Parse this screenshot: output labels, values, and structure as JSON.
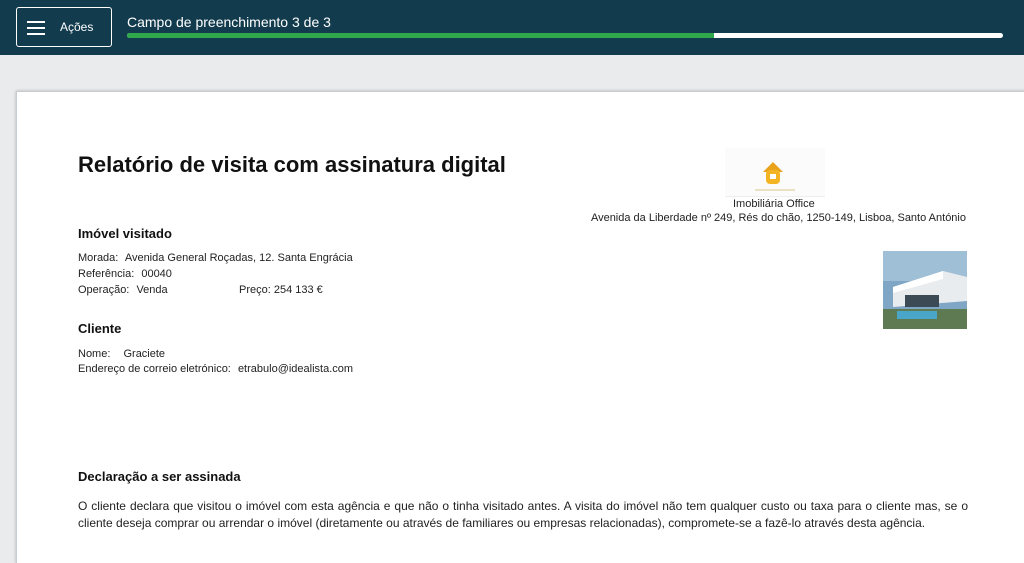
{
  "header": {
    "actions_label": "Ações",
    "progress_text": "Campo de preenchimento 3 de 3",
    "progress_fraction": 0.67
  },
  "document": {
    "title": "Relatório de visita com assinatura digital",
    "agency": {
      "name": "Imobiliária Office",
      "address": "Avenida da Liberdade nº 249, Rés do chão, 1250-149, Lisboa, Santo António"
    },
    "property": {
      "section_title": "Imóvel visitado",
      "address_label": "Morada:",
      "address_value": "Avenida General Roçadas, 12. Santa Engrácia",
      "reference_label": "Referência:",
      "reference_value": "00040",
      "operation_label": "Operação:",
      "operation_value": "Venda",
      "price_label": "Preço:",
      "price_value": "254 133 €"
    },
    "client": {
      "section_title": "Cliente",
      "name_label": "Nome:",
      "name_value": "Graciete",
      "email_label": "Endereço de correio eletrónico:",
      "email_value": "etrabulo@idealista.com"
    },
    "declaration": {
      "section_title": "Declaração a ser assinada",
      "text": "O cliente declara que visitou o imóvel com esta agência e que não o tinha visitado antes. A visita do imóvel não tem qualquer custo ou taxa para o cliente mas, se o cliente deseja comprar ou arrendar o imóvel (diretamente ou através de familiares ou empresas relacionadas), compromete-se a fazê-lo através desta agência."
    }
  },
  "colors": {
    "header_bg": "#123c4e",
    "progress_fill": "#2ea84a"
  }
}
